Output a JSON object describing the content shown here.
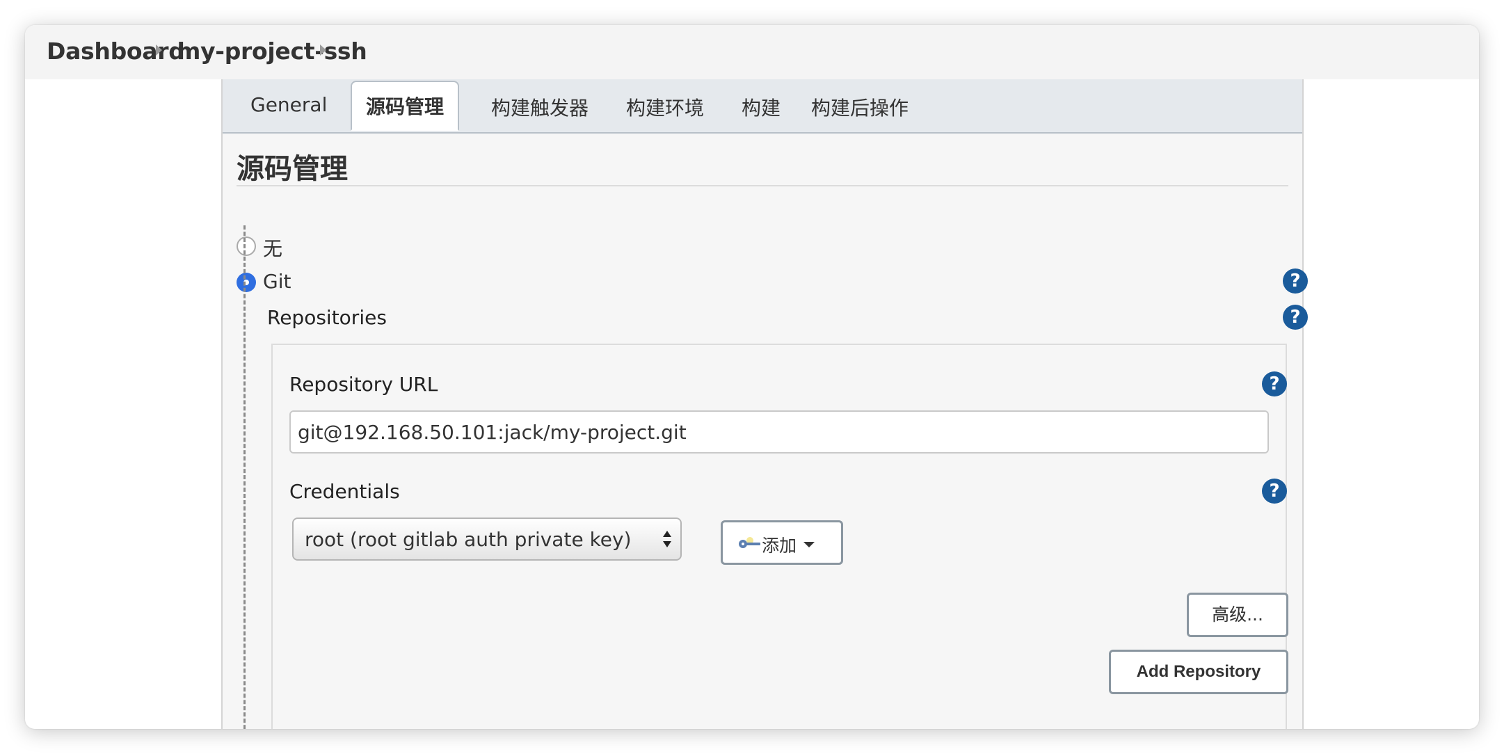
{
  "breadcrumb": {
    "items": [
      "Dashboard",
      "my-project-ssh"
    ]
  },
  "tabs": [
    {
      "label": "General",
      "active": false
    },
    {
      "label": "源码管理",
      "active": true
    },
    {
      "label": "构建触发器",
      "active": false
    },
    {
      "label": "构建环境",
      "active": false
    },
    {
      "label": "构建",
      "active": false
    },
    {
      "label": "构建后操作",
      "active": false
    }
  ],
  "section": {
    "title": "源码管理"
  },
  "scm_options": [
    {
      "label": "无",
      "selected": false
    },
    {
      "label": "Git",
      "selected": true
    }
  ],
  "git": {
    "repositories_label": "Repositories",
    "repository_url_label": "Repository URL",
    "repository_url_value": "git@192.168.50.101:jack/my-project.git",
    "credentials_label": "Credentials",
    "credentials_selected": "root (root gitlab auth private key)",
    "add_button_label": "添加",
    "advanced_button_label": "高级...",
    "add_repository_button_label": "Add Repository"
  },
  "help_glyph": "?",
  "colors": {
    "radio_selected": "#2f6ee0",
    "help_icon": "#1a5b9b",
    "tab_strip": "#e5e9ed"
  },
  "icons": {
    "breadcrumb_separator": "chevron-right-icon",
    "help": "help-icon",
    "credential_key": "key-icon",
    "dropdown": "caret-down-icon"
  }
}
